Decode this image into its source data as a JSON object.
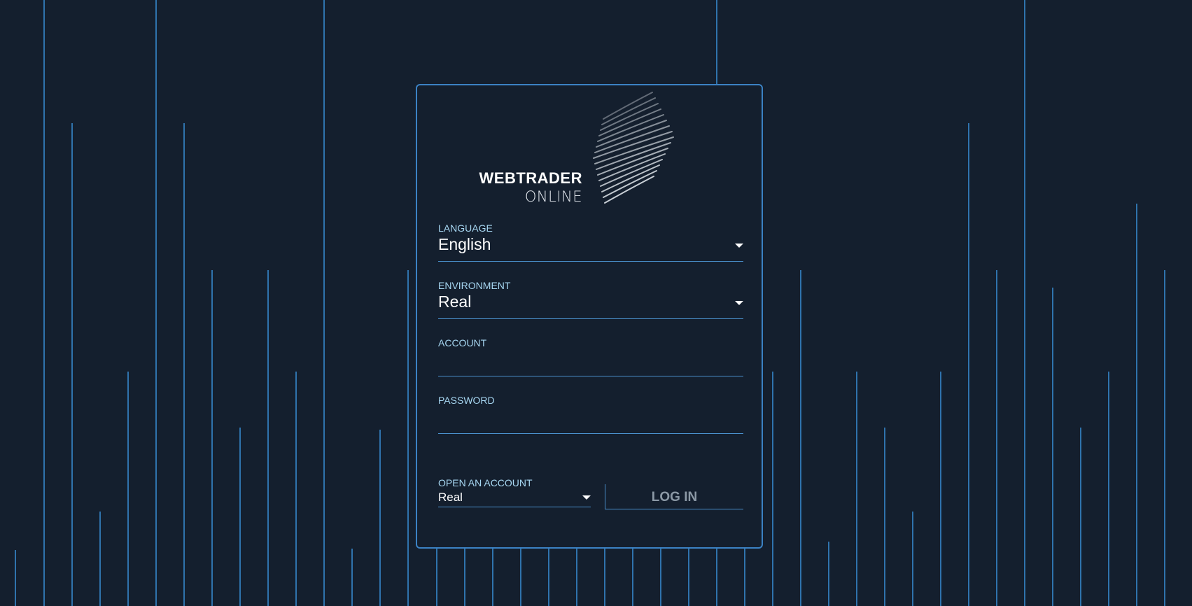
{
  "app": {
    "logo_line1": "WEBTRADER",
    "logo_line2": "ONLINE"
  },
  "form": {
    "language": {
      "label": "LANGUAGE",
      "value": "English"
    },
    "environment": {
      "label": "ENVIRONMENT",
      "value": "Real"
    },
    "account": {
      "label": "ACCOUNT",
      "value": ""
    },
    "password": {
      "label": "PASSWORD",
      "value": ""
    },
    "open_account": {
      "label": "OPEN AN ACCOUNT",
      "value": "Real"
    },
    "login_label": "LOG IN"
  },
  "colors": {
    "background": "#141f2e",
    "accent_line": "#2f73ad",
    "label": "#a7d7f2",
    "card_border": "#3b82c4"
  }
}
